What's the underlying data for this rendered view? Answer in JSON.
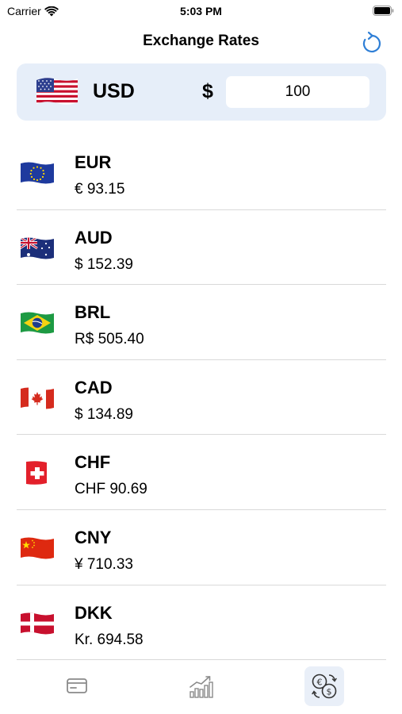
{
  "status_bar": {
    "carrier": "Carrier",
    "time": "5:03 PM"
  },
  "nav": {
    "title": "Exchange Rates",
    "refresh_icon": "refresh-icon"
  },
  "base": {
    "code": "USD",
    "symbol": "$",
    "amount": "100",
    "flag_icon": "flag-us-icon"
  },
  "rates": [
    {
      "code": "EUR",
      "value": "€ 93.15",
      "flag_icon": "flag-eu-icon"
    },
    {
      "code": "AUD",
      "value": "$ 152.39",
      "flag_icon": "flag-au-icon"
    },
    {
      "code": "BRL",
      "value": "R$ 505.40",
      "flag_icon": "flag-br-icon"
    },
    {
      "code": "CAD",
      "value": "$ 134.89",
      "flag_icon": "flag-ca-icon"
    },
    {
      "code": "CHF",
      "value": "CHF 90.69",
      "flag_icon": "flag-ch-icon"
    },
    {
      "code": "CNY",
      "value": "¥ 710.33",
      "flag_icon": "flag-cn-icon"
    },
    {
      "code": "DKK",
      "value": "Kr. 694.58",
      "flag_icon": "flag-dk-icon"
    }
  ],
  "tabs": [
    {
      "icon": "credit-card-icon",
      "active": false
    },
    {
      "icon": "bar-chart-icon",
      "active": false
    },
    {
      "icon": "currency-exchange-icon",
      "active": true
    }
  ],
  "colors": {
    "accent": "#2f7fd6",
    "card_background": "#e6eef9",
    "tab_active_background": "#e9eff8",
    "divider": "#d9d9d9"
  }
}
